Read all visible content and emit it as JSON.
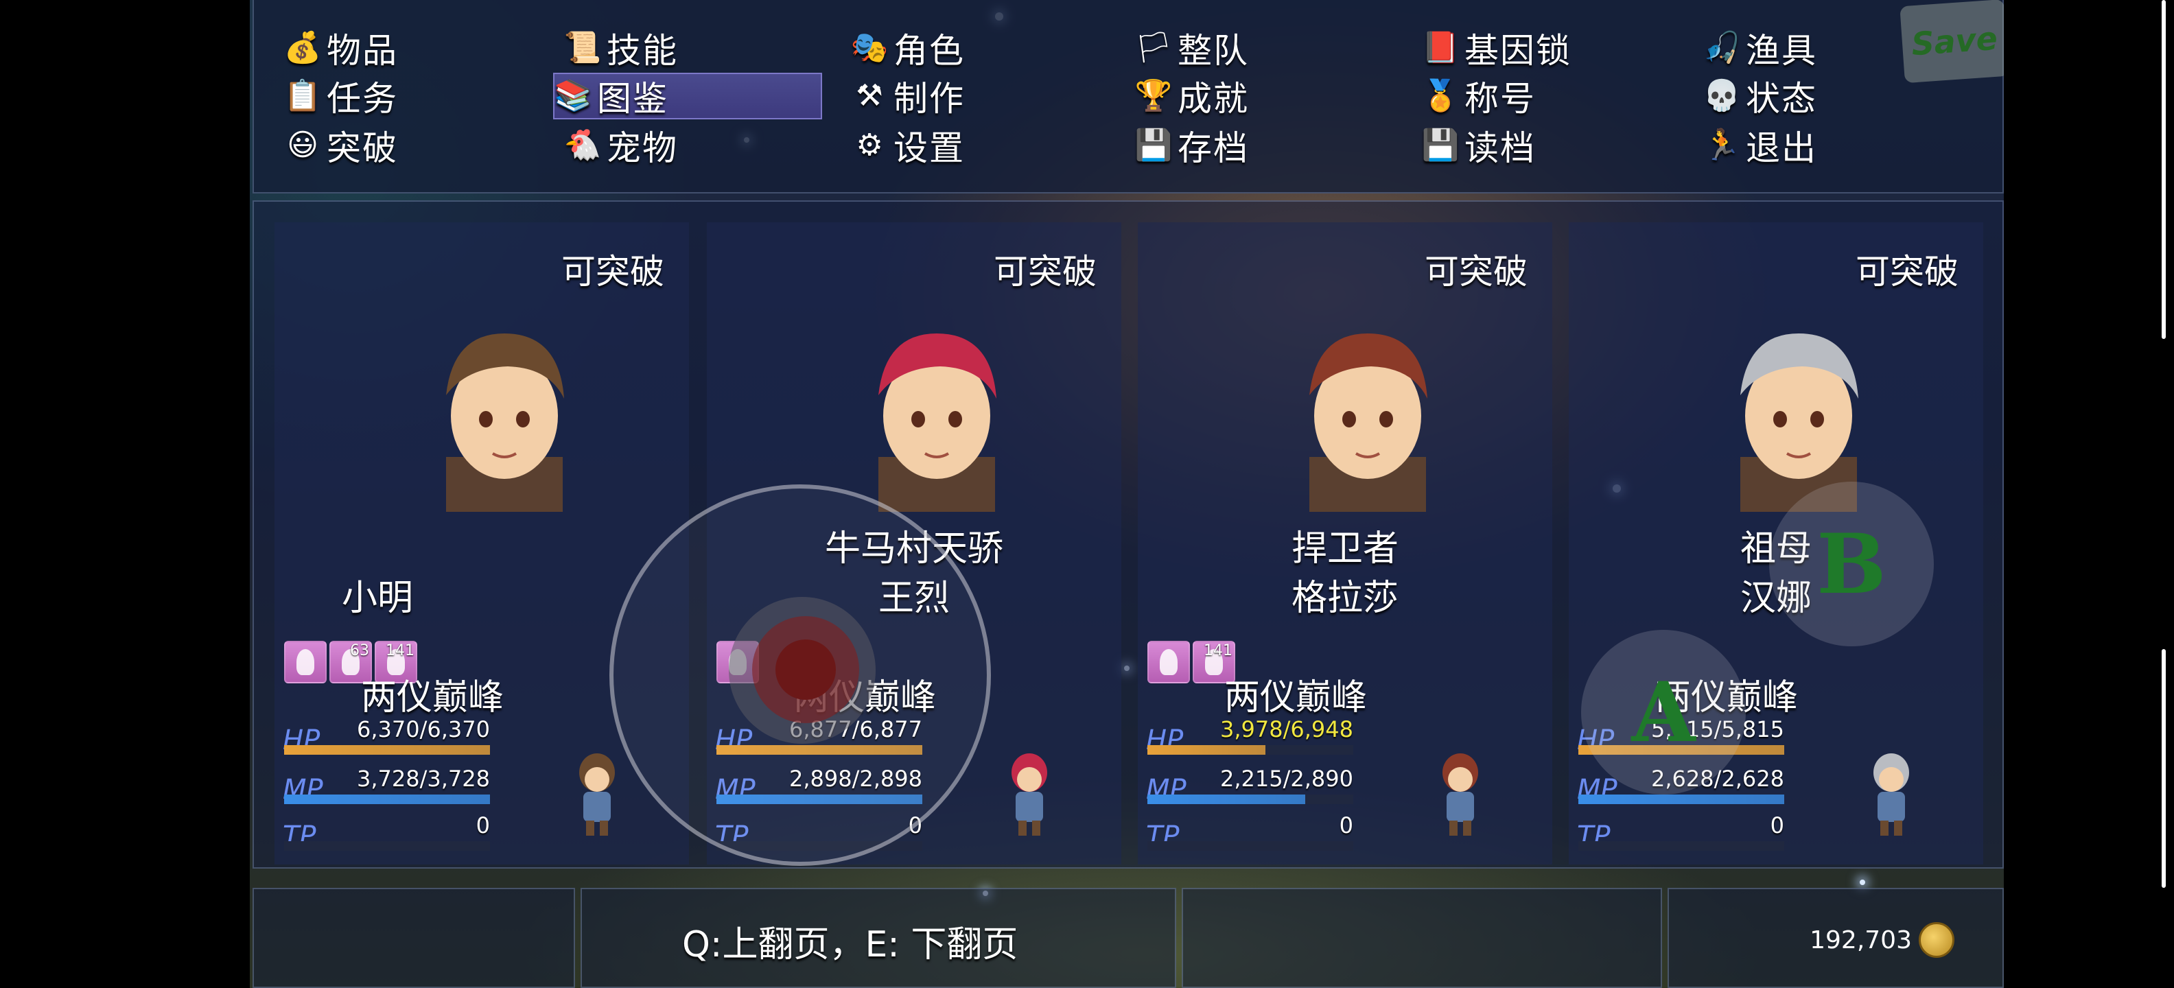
{
  "menu": {
    "items": [
      {
        "label": "物品",
        "icon": "money-bag-icon",
        "glyph": "💰"
      },
      {
        "label": "技能",
        "icon": "skill-scroll-icon",
        "glyph": "📜"
      },
      {
        "label": "角色",
        "icon": "theater-mask-icon",
        "glyph": "🎭"
      },
      {
        "label": "整队",
        "icon": "flag-icon",
        "glyph": "🏳"
      },
      {
        "label": "基因锁",
        "icon": "book-icon",
        "glyph": "📕"
      },
      {
        "label": "渔具",
        "icon": "fishing-rod-icon",
        "glyph": "🎣"
      },
      {
        "label": "任务",
        "icon": "quest-scroll-icon",
        "glyph": "📋"
      },
      {
        "label": "图鉴",
        "icon": "encyclopedia-icon",
        "glyph": "📚"
      },
      {
        "label": "制作",
        "icon": "anvil-icon",
        "glyph": "⚒"
      },
      {
        "label": "成就",
        "icon": "trophy-icon",
        "glyph": "🏆"
      },
      {
        "label": "称号",
        "icon": "medal-icon",
        "glyph": "🏅"
      },
      {
        "label": "状态",
        "icon": "skull-icon",
        "glyph": "💀"
      },
      {
        "label": "突破",
        "icon": "face-sparkle-icon",
        "glyph": "😃"
      },
      {
        "label": "宠物",
        "icon": "chicken-icon",
        "glyph": "🐔"
      },
      {
        "label": "设置",
        "icon": "gear-icon",
        "glyph": "⚙"
      },
      {
        "label": "存档",
        "icon": "floppy-disk-icon",
        "glyph": "💾"
      },
      {
        "label": "读档",
        "icon": "floppy-disk-icon",
        "glyph": "💾"
      },
      {
        "label": "退出",
        "icon": "running-ninja-icon",
        "glyph": "🏃"
      }
    ],
    "active_label": "图鉴",
    "save_button": "Save"
  },
  "party": [
    {
      "status": "可突破",
      "title": "",
      "name": "小明",
      "class": "两仪巅峰",
      "states": [
        {
          "num": ""
        },
        {
          "num": "63"
        },
        {
          "num": "141"
        }
      ],
      "hp": "6,370/6,370",
      "hp_ratio": 1.0,
      "mp": "3,728/3,728",
      "mp_ratio": 1.0,
      "tp": "0",
      "tp_ratio": 0,
      "hp_color": "#ffffff",
      "hair": "#6b4a2e"
    },
    {
      "status": "可突破",
      "title": "牛马村天骄",
      "name": "王烈",
      "class": "两仪巅峰",
      "states": [
        {
          "num": ""
        }
      ],
      "hp": "6,877/6,877",
      "hp_ratio": 1.0,
      "mp": "2,898/2,898",
      "mp_ratio": 1.0,
      "tp": "0",
      "tp_ratio": 0,
      "hp_color": "#ffffff",
      "hair": "#c42a4a"
    },
    {
      "status": "可突破",
      "title": "捍卫者",
      "name": "格拉莎",
      "class": "两仪巅峰",
      "states": [
        {
          "num": ""
        },
        {
          "num": "141"
        }
      ],
      "hp": "3,978/6,948",
      "hp_ratio": 0.573,
      "mp": "2,215/2,890",
      "mp_ratio": 0.766,
      "tp": "0",
      "tp_ratio": 0,
      "hp_color": "#f2e840",
      "hair": "#8b3a28"
    },
    {
      "status": "可突破",
      "title": "祖母",
      "name": "汉娜",
      "class": "两仪巅峰",
      "states": [],
      "hp": "5,815/5,815",
      "hp_ratio": 1.0,
      "mp": "2,628/2,628",
      "mp_ratio": 1.0,
      "tp": "0",
      "tp_ratio": 0,
      "hp_color": "#ffffff",
      "hair": "#b9bcc2"
    }
  ],
  "labels": {
    "hp": "HP",
    "mp": "MP",
    "tp": "TP"
  },
  "footer": {
    "page_hint": "Q:上翻页，E: 下翻页",
    "gold": "192,703"
  },
  "controls": {
    "a_label": "A",
    "b_label": "B"
  },
  "colors": {
    "hp_gauge": "#e8a23a",
    "mp_gauge": "#3a8ee8",
    "tp_gauge": "#3a7a30",
    "menu_active": "#4a4a8e"
  }
}
